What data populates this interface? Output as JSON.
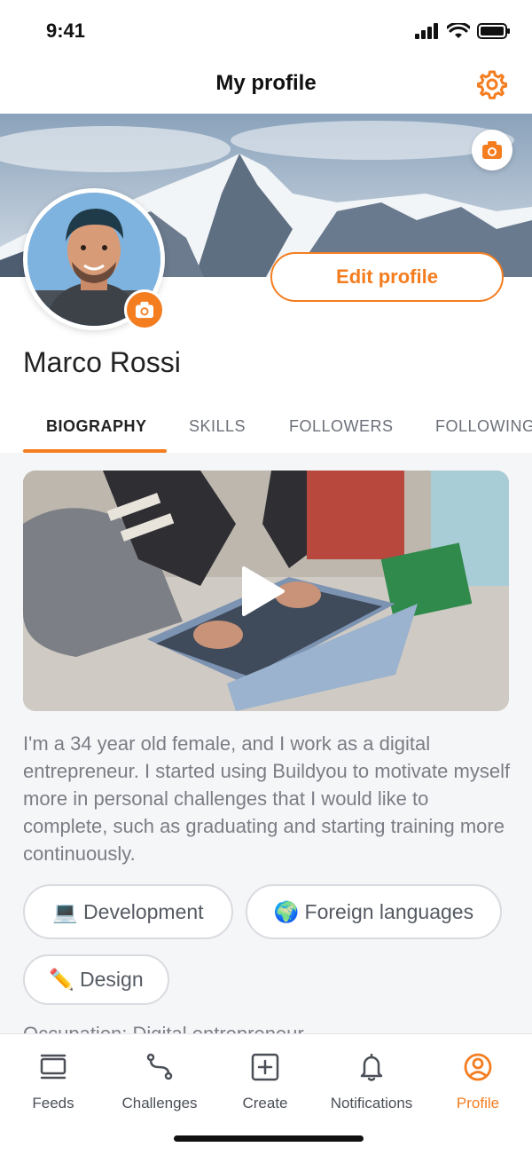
{
  "status_bar": {
    "time": "9:41"
  },
  "header": {
    "title": "My profile",
    "settings_icon": "gear-icon"
  },
  "profile": {
    "name": "Marco Rossi",
    "edit_label": "Edit profile"
  },
  "tabs": [
    {
      "label": "BIOGRAPHY",
      "active": true
    },
    {
      "label": "SKILLS",
      "active": false
    },
    {
      "label": "FOLLOWERS",
      "active": false
    },
    {
      "label": "FOLLOWING",
      "active": false
    }
  ],
  "bio": {
    "text": "I'm a 34 year old female, and I work as a digital entrepreneur. I started using Buildyou to motivate myself more in personal challenges that I would like to complete, such as graduating and starting training more continuously.",
    "occupation": "Occupation: Digital entrepreneur"
  },
  "interests": [
    {
      "emoji": "💻",
      "label": "Development"
    },
    {
      "emoji": "🌍",
      "label": "Foreign languages"
    },
    {
      "emoji": "✏️",
      "label": "Design"
    }
  ],
  "tab_bar": [
    {
      "label": "Feeds",
      "icon": "feeds-icon",
      "active": false
    },
    {
      "label": "Challenges",
      "icon": "challenges-icon",
      "active": false
    },
    {
      "label": "Create",
      "icon": "create-icon",
      "active": false
    },
    {
      "label": "Notifications",
      "icon": "bell-icon",
      "active": false
    },
    {
      "label": "Profile",
      "icon": "profile-icon",
      "active": true
    }
  ],
  "colors": {
    "accent": "#f47d20",
    "background": "#f5f6f8"
  }
}
